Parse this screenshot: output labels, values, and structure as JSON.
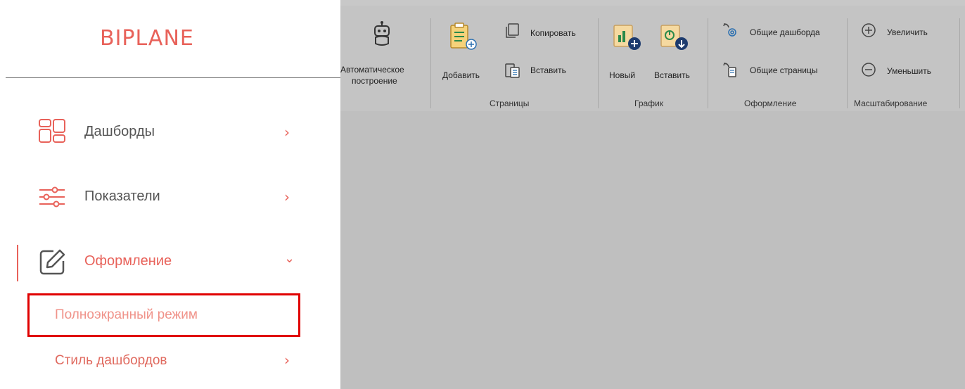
{
  "sidebar": {
    "logo": "BIPLANE",
    "items": [
      {
        "label": "Дашборды",
        "chevron": "›",
        "icon": "dashboard-grid-icon"
      },
      {
        "label": "Показатели",
        "chevron": "›",
        "icon": "sliders-icon"
      },
      {
        "label": "Оформление",
        "chevron": "⌄",
        "icon": "edit-icon",
        "active": true
      }
    ],
    "subitems": [
      {
        "label": "Полноэкранный режим",
        "highlighted": true
      },
      {
        "label": "Стиль дашбордов",
        "chevron": "›"
      }
    ]
  },
  "ribbon": {
    "auto_build_line1": "Автоматическое",
    "auto_build_line2": "построение",
    "add": "Добавить",
    "copy": "Копировать",
    "paste_page": "Вставить",
    "pages_group": "Страницы",
    "new_chart": "Новый",
    "paste_chart": "Вставить",
    "chart_group": "График",
    "shared_dashboards": "Общие дашборда",
    "shared_pages": "Общие страницы",
    "design_group": "Оформление",
    "zoom_in": "Увеличить",
    "zoom_out": "Уменьшить",
    "zoom_group": "Масштабирование"
  },
  "colors": {
    "accent": "#e8625a",
    "highlight_border": "#e00000",
    "workspace": "#bfbfbf",
    "ribbon_bg": "#c4c4c4"
  }
}
